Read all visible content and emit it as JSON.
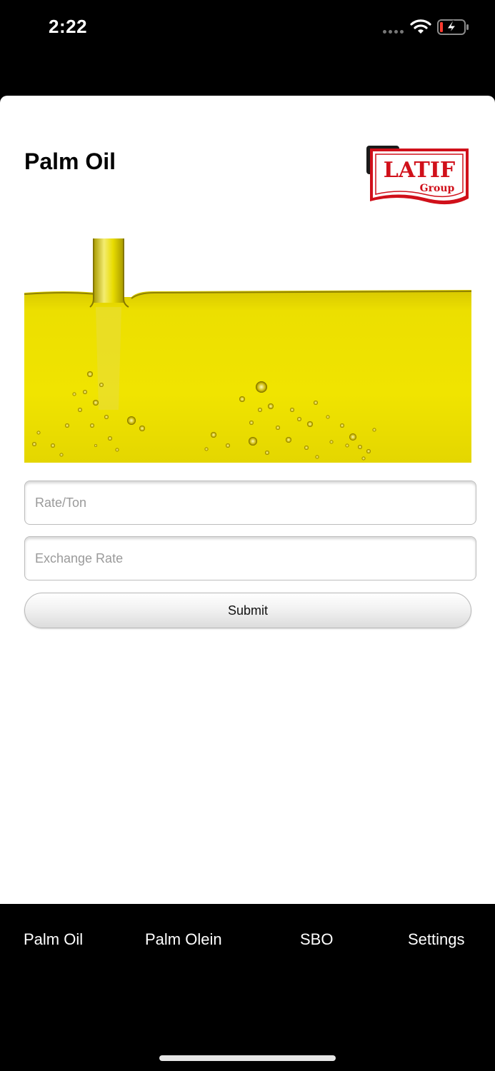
{
  "status_bar": {
    "time": "2:22",
    "icons": [
      "signal-dots-icon",
      "wifi-icon",
      "battery-charging-icon"
    ]
  },
  "header": {
    "title": "Palm Oil",
    "logo": {
      "text": "LATIF",
      "subtext": "Group",
      "color": "#d0101a"
    }
  },
  "hero": {
    "description_icon": "oil-pour-image",
    "oil_color": "#eee300"
  },
  "form": {
    "rate_placeholder": "Rate/Ton",
    "rate_value": "",
    "exchange_placeholder": "Exchange Rate",
    "exchange_value": "",
    "submit_label": "Submit"
  },
  "tabs": [
    {
      "label": "Palm Oil"
    },
    {
      "label": "Palm Olein"
    },
    {
      "label": "SBO"
    },
    {
      "label": "Settings"
    }
  ]
}
